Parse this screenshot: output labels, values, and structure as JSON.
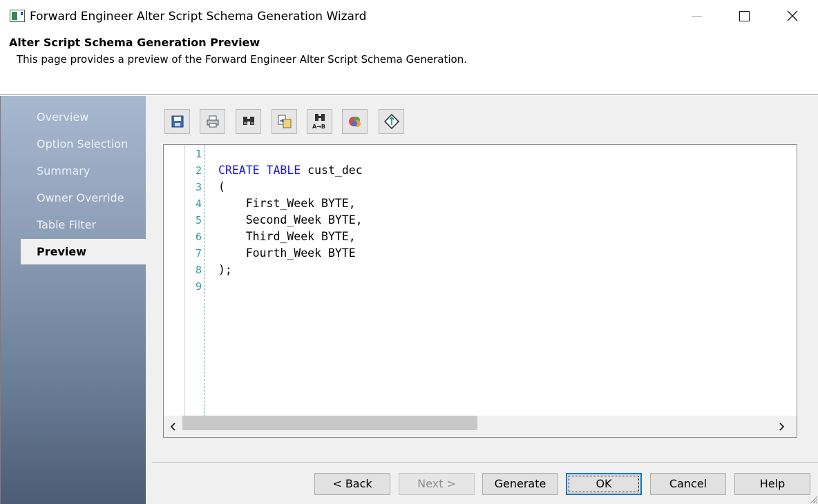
{
  "window": {
    "title": "Forward Engineer Alter Script Schema Generation Wizard"
  },
  "header": {
    "title": "Alter Script Schema Generation Preview",
    "description": "This page provides a preview of the Forward Engineer Alter Script Schema Generation."
  },
  "sidebar": {
    "items": [
      {
        "label": "Overview"
      },
      {
        "label": "Option Selection"
      },
      {
        "label": "Summary"
      },
      {
        "label": "Owner Override"
      },
      {
        "label": "Table Filter"
      },
      {
        "label": "Preview",
        "active": true
      }
    ]
  },
  "toolbar": {
    "buttons": [
      {
        "icon": "save-icon"
      },
      {
        "icon": "print-icon"
      },
      {
        "icon": "find-icon"
      },
      {
        "icon": "copy-icon"
      },
      {
        "icon": "replace-icon"
      },
      {
        "icon": "color-icon"
      },
      {
        "icon": "goto-icon"
      }
    ]
  },
  "editor": {
    "line_numbers": [
      "1",
      "2",
      "3",
      "4",
      "5",
      "6",
      "7",
      "8",
      "9"
    ],
    "lines": [
      {
        "kw": "",
        "text": ""
      },
      {
        "kw": "CREATE TABLE",
        "text": " cust_dec"
      },
      {
        "kw": "",
        "text": "("
      },
      {
        "kw": "",
        "text": "    First_Week BYTE,"
      },
      {
        "kw": "",
        "text": "    Second_Week BYTE,"
      },
      {
        "kw": "",
        "text": "    Third_Week BYTE,"
      },
      {
        "kw": "",
        "text": "    Fourth_Week BYTE"
      },
      {
        "kw": "",
        "text": ");"
      },
      {
        "kw": "",
        "text": ""
      }
    ],
    "keyword_color": "#1818e8",
    "line_number_color": "#2f9c9c"
  },
  "buttons": {
    "back": "< Back",
    "next": "Next >",
    "generate": "Generate",
    "ok": "OK",
    "cancel": "Cancel",
    "help": "Help"
  }
}
